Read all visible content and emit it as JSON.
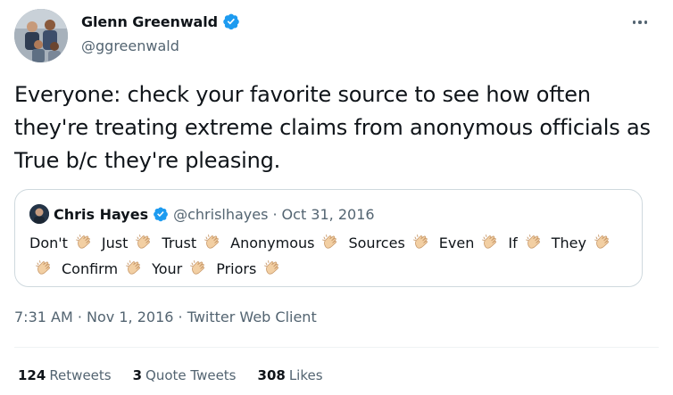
{
  "author": {
    "name": "Glenn Greenwald",
    "handle": "@ggreenwald",
    "verified_icon": "verified-badge-icon"
  },
  "tweet": {
    "text": "Everyone: check your favorite source to see how often they're treating extreme claims from anonymous officials as True b/c they're pleasing."
  },
  "quoted_tweet": {
    "name": "Chris Hayes",
    "handle": "@chrislhayes",
    "separator": "·",
    "date": "Oct 31, 2016",
    "words": [
      "Don't",
      "Just",
      "Trust",
      "Anonymous",
      "Sources",
      "Even",
      "If",
      "They",
      "",
      "Confirm",
      "Your",
      "Priors"
    ],
    "emoji_icon": "clapping-hands-icon"
  },
  "meta": {
    "time": "7:31 AM",
    "separator": "·",
    "date": "Nov 1, 2016",
    "client": "Twitter Web Client"
  },
  "stats": [
    {
      "count": "124",
      "label": "Retweets"
    },
    {
      "count": "3",
      "label": "Quote Tweets"
    },
    {
      "count": "308",
      "label": "Likes"
    }
  ],
  "colors": {
    "verified": "#1d9bf0",
    "secondary_text": "#536471",
    "primary_text": "#0f1419",
    "border": "#cfd9de"
  }
}
